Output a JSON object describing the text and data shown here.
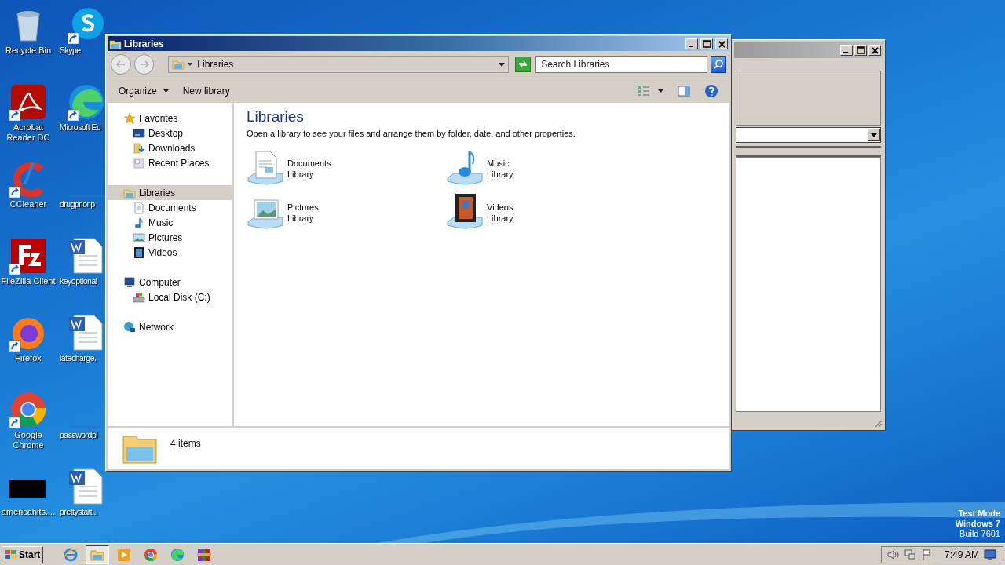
{
  "desktop": {
    "icons": [
      {
        "label": "Recycle Bin",
        "kind": "recycle"
      },
      {
        "label": "Skype",
        "kind": "skype"
      },
      {
        "label": "Acrobat Reader DC",
        "kind": "acrobat"
      },
      {
        "label": "Microsoft Ed",
        "kind": "edge"
      },
      {
        "label": "CCleaner",
        "kind": "ccleaner"
      },
      {
        "label": "drugprior.p",
        "kind": "hidden"
      },
      {
        "label": "FileZilla Client",
        "kind": "filezilla"
      },
      {
        "label": "keyoptional",
        "kind": "word"
      },
      {
        "label": "Firefox",
        "kind": "firefox"
      },
      {
        "label": "latecharge.",
        "kind": "word"
      },
      {
        "label": "Google Chrome",
        "kind": "chrome"
      },
      {
        "label": "passwordpl",
        "kind": "hidden"
      },
      {
        "label": "americahits....",
        "kind": "black"
      },
      {
        "label": "prettystart...",
        "kind": "word"
      }
    ],
    "system_text": [
      "Test Mode",
      "Windows 7",
      "Build 7601"
    ]
  },
  "explorer": {
    "title": "Libraries",
    "address": "Libraries",
    "search": {
      "placeholder": "Search Libraries"
    },
    "toolbar": [
      {
        "label": "Organize",
        "dropdown": true
      },
      {
        "label": "New library",
        "dropdown": false
      }
    ],
    "navigation": [
      {
        "label": "Favorites",
        "kind": "star",
        "selected": false,
        "children": [
          {
            "label": "Desktop",
            "kind": "desktop",
            "selected": false
          },
          {
            "label": "Downloads",
            "kind": "downloads",
            "selected": false
          },
          {
            "label": "Recent Places",
            "kind": "recent",
            "selected": false
          }
        ]
      },
      {
        "label": "Libraries",
        "kind": "library",
        "selected": true,
        "children": [
          {
            "label": "Documents",
            "kind": "documents",
            "selected": false
          },
          {
            "label": "Music",
            "kind": "music",
            "selected": false
          },
          {
            "label": "Pictures",
            "kind": "pictures",
            "selected": false
          },
          {
            "label": "Videos",
            "kind": "videos",
            "selected": false
          }
        ]
      },
      {
        "label": "Computer",
        "kind": "computer",
        "selected": false,
        "children": [
          {
            "label": "Local Disk (C:)",
            "kind": "disk",
            "selected": false
          }
        ]
      },
      {
        "label": "Network",
        "kind": "network",
        "selected": false
      }
    ],
    "heading": "Libraries",
    "description": "Open a library to see your files and arrange them by folder, date, and other properties.",
    "items": [
      {
        "name": "Documents",
        "type": "Library",
        "kind": "documents"
      },
      {
        "name": "Music",
        "type": "Library",
        "kind": "music"
      },
      {
        "name": "Pictures",
        "type": "Library",
        "kind": "pictures"
      },
      {
        "name": "Videos",
        "type": "Library",
        "kind": "videos"
      }
    ],
    "details": "4 items"
  },
  "taskbar": {
    "start": "Start",
    "apps": [
      {
        "kind": "ie",
        "selected": false
      },
      {
        "kind": "explorer",
        "selected": true
      },
      {
        "kind": "media",
        "selected": false
      },
      {
        "kind": "chrome",
        "selected": false
      },
      {
        "kind": "edge",
        "selected": false
      },
      {
        "kind": "winrar",
        "selected": false
      }
    ],
    "clock": "7:49 AM"
  }
}
